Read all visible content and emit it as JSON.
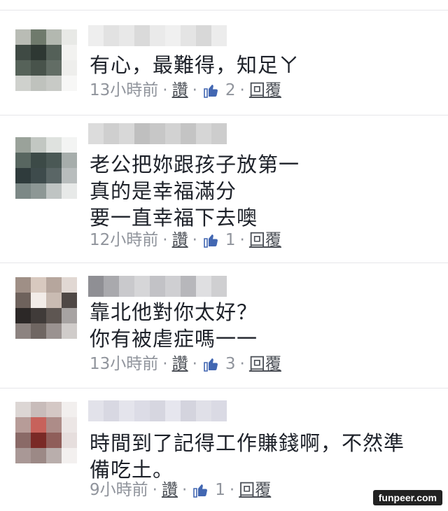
{
  "comments": [
    {
      "lines": [
        "有心，最難得，知足ㄚ"
      ],
      "time": "13小時前",
      "like_label": "讚",
      "like_count": "2",
      "reply_label": "回覆",
      "avatar_colors": [
        "#b9bcb5",
        "#6f7a6c",
        "#b3b8b0",
        "#e8e9e6",
        "#3f4a44",
        "#2e3833",
        "#546058",
        "#f2f2f0",
        "#566259",
        "#48534b",
        "#626d65",
        "#eeeeec",
        "#cfd1cd",
        "#bfc2bd",
        "#c8cac6",
        "#f7f7f6"
      ],
      "name_colors": [
        "#eeeeee",
        "#e2e2e2",
        "#e8e8e8",
        "#dadada",
        "#eaeaea",
        "#f0f0f0",
        "#e4e4e4",
        "#d8d8d8",
        "#ececec"
      ]
    },
    {
      "lines": [
        "老公把妳跟孩子放第一",
        "真的是幸福滿分",
        "要一直幸福下去噢"
      ],
      "time": "12小時前",
      "like_label": "讚",
      "like_count": "1",
      "reply_label": "回覆",
      "avatar_colors": [
        "#9aa29a",
        "#c2c7c2",
        "#dfe2df",
        "#f3f4f3",
        "#586660",
        "#3c4a47",
        "#4a5855",
        "#a6adab",
        "#2f3b3c",
        "#3e4b4c",
        "#5a6666",
        "#b8bdbd",
        "#7c8886",
        "#8d9795",
        "#bfc4c3",
        "#e7e9e8"
      ],
      "name_colors": [
        "#dcdcdc",
        "#cfcfcf",
        "#d8d8d8",
        "#bfbfbf",
        "#c7c7c7",
        "#d2d2d2",
        "#c4c4c4",
        "#d6d6d6",
        "#cdcdcd"
      ]
    },
    {
      "lines": [
        "靠北他對你太好？",
        "你有被虐症嗎一一"
      ],
      "time": "13小時前",
      "like_label": "讚",
      "like_count": "3",
      "reply_label": "回覆",
      "avatar_colors": [
        "#9f8f86",
        "#d8c9bf",
        "#b6a69d",
        "#e1d8d3",
        "#6e625c",
        "#f2ece8",
        "#c9bbb2",
        "#4f4845",
        "#2c2827",
        "#403b39",
        "#5e5652",
        "#a7a3a2",
        "#8c8380",
        "#6f6662",
        "#9a9290",
        "#d0ccca"
      ],
      "name_colors": [
        "#8f8f94",
        "#a9a9ad",
        "#c9c9cc",
        "#d6d6d8",
        "#c2c2c6",
        "#cfcfd2",
        "#b7b7bb",
        "#dfdfe1",
        "#cfcfd1"
      ]
    },
    {
      "lines": [
        "時間到了記得工作賺錢啊，不然準",
        "備吃土。"
      ],
      "time": "9小時前",
      "like_label": "讚",
      "like_count": "1",
      "reply_label": "回覆",
      "avatar_colors": [
        "#dcd6d4",
        "#c8bcba",
        "#d4c8c5",
        "#f2efee",
        "#b79c98",
        "#c7625b",
        "#ad8c88",
        "#ece6e5",
        "#8a6a67",
        "#7a2a26",
        "#8f5e5a",
        "#e6dedd",
        "#a99896",
        "#9c8986",
        "#b9aeac",
        "#f3f0ef"
      ],
      "name_colors": [
        "#e2e2ea",
        "#d8d8e2",
        "#e4e4ec",
        "#dcdce6",
        "#d6d6e0",
        "#e6e6ee",
        "#d4d4de",
        "#e0e0e8",
        "#dadae4"
      ]
    }
  ],
  "watermark": "funpeer.com",
  "colors": {
    "text": "#1d2129",
    "meta": "#90949c",
    "link": "#4b4f56",
    "like_blue": "#4267b2"
  }
}
